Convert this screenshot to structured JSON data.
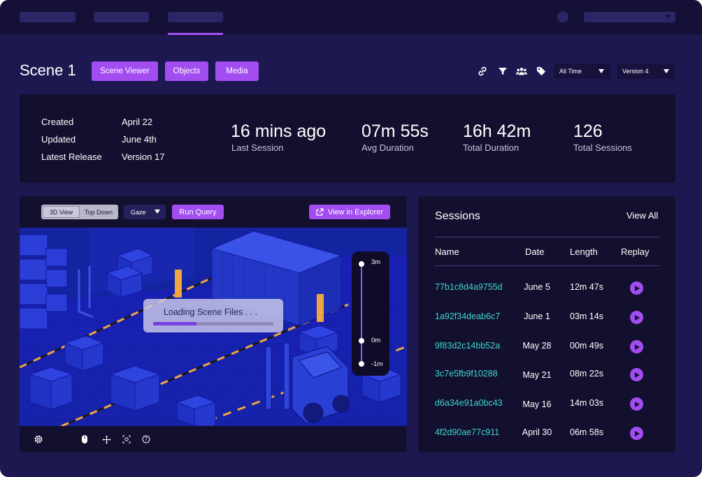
{
  "colors": {
    "background": "#1e1850",
    "panel": "#13102f",
    "accent": "#a24df0",
    "session_link": "#3dd6c8"
  },
  "header": {
    "title": "Scene 1",
    "tabs": [
      {
        "label": "Scene Viewer"
      },
      {
        "label": "Objects"
      },
      {
        "label": "Media"
      }
    ],
    "icons": [
      "link-icon",
      "filter-icon",
      "users-icon",
      "tag-icon"
    ],
    "time_filter": "All Time",
    "version_filter": "Version 4"
  },
  "summary": {
    "meta": [
      {
        "label": "Created",
        "value": "April 22"
      },
      {
        "label": "Updated",
        "value": "June 4th"
      },
      {
        "label": "Latest Release",
        "value": "Version 17"
      }
    ],
    "stats": [
      {
        "value": "16 mins ago",
        "label": "Last Session"
      },
      {
        "value": "07m 55s",
        "label": "Avg Duration"
      },
      {
        "value": "16h 42m",
        "label": "Total Duration"
      },
      {
        "value": "126",
        "label": "Total Sessions"
      }
    ]
  },
  "viewer": {
    "view_toggle": {
      "active": "3D View",
      "inactive": "Top Down"
    },
    "mode_select": "Gaze",
    "run_query": "Run Query",
    "view_in_explorer": "View in Explorer",
    "loading_text": "Loading Scene Files . . .",
    "loading_progress": 0.36,
    "timeline": {
      "top": "3m",
      "mid": "0m",
      "bottom": "-1m"
    },
    "footer_icons": [
      "settings-icon",
      "mouse-icon",
      "move-icon",
      "camera-icon",
      "help-icon"
    ]
  },
  "sessions": {
    "title": "Sessions",
    "view_all": "View All",
    "columns": {
      "name": "Name",
      "date": "Date",
      "length": "Length",
      "replay": "Replay"
    },
    "rows": [
      {
        "name": "77b1c8d4a9755d",
        "date": "June 5",
        "length": "12m 47s"
      },
      {
        "name": "1a92f34deab6c7",
        "date": "June 1",
        "length": "03m 14s"
      },
      {
        "name": "9f83d2c14bb52a",
        "date": "May 28",
        "length": "00m 49s"
      },
      {
        "name": "3c7e5fb9f10288",
        "date": "May 21",
        "length": "08m 22s"
      },
      {
        "name": "d6a34e91a0bc43",
        "date": "May 16",
        "length": "14m 03s"
      },
      {
        "name": "4f2d90ae77c911",
        "date": "April 30",
        "length": "06m 58s"
      }
    ]
  }
}
